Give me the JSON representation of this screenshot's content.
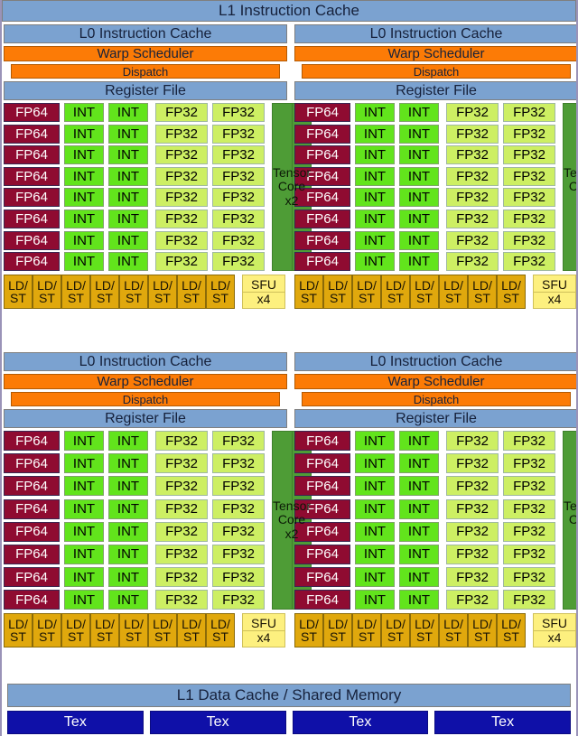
{
  "diagram": {
    "title": "L1 Instruction Cache",
    "top_cache_label": "L1 Instruction Cache",
    "bottom_cache_label": "L1 Data Cache / Shared Memory"
  },
  "partition": {
    "cache_label": "L0 Instruction Cache",
    "warp_label": "Warp Scheduler",
    "dispatch_label": "Dispatch",
    "register_label": "Register File",
    "fp64_label": "FP64",
    "int_label": "INT",
    "fp32_label": "FP32",
    "tensor_label": "Tensor Core",
    "tensor_count": "x2",
    "ldst_top": "LD/",
    "ldst_bottom": "ST",
    "sfu_label": "SFU",
    "sfu_count": "x4",
    "core_rows": 8,
    "ldst_count": 8
  },
  "texture_units": [
    {
      "label": "Tex"
    },
    {
      "label": "Tex"
    },
    {
      "label": "Tex"
    },
    {
      "label": "Tex"
    }
  ],
  "partitions": [
    {
      "id": "sm-partition-top-left"
    },
    {
      "id": "sm-partition-top-right"
    },
    {
      "id": "sm-partition-bottom-left"
    },
    {
      "id": "sm-partition-bottom-right"
    }
  ],
  "colors": {
    "cache_blue": "#7ba2d0",
    "scheduler_orange": "#fc7b06",
    "fp64_red": "#8f0b31",
    "int_green": "#62e41c",
    "fp32_lightgreen": "#cdef63",
    "tensor_green": "#4e9c36",
    "ldst_gold": "#e0a80d",
    "sfu_yellow": "#fdf07f",
    "tex_blue": "#0f10a8",
    "background": "#ffffff"
  }
}
